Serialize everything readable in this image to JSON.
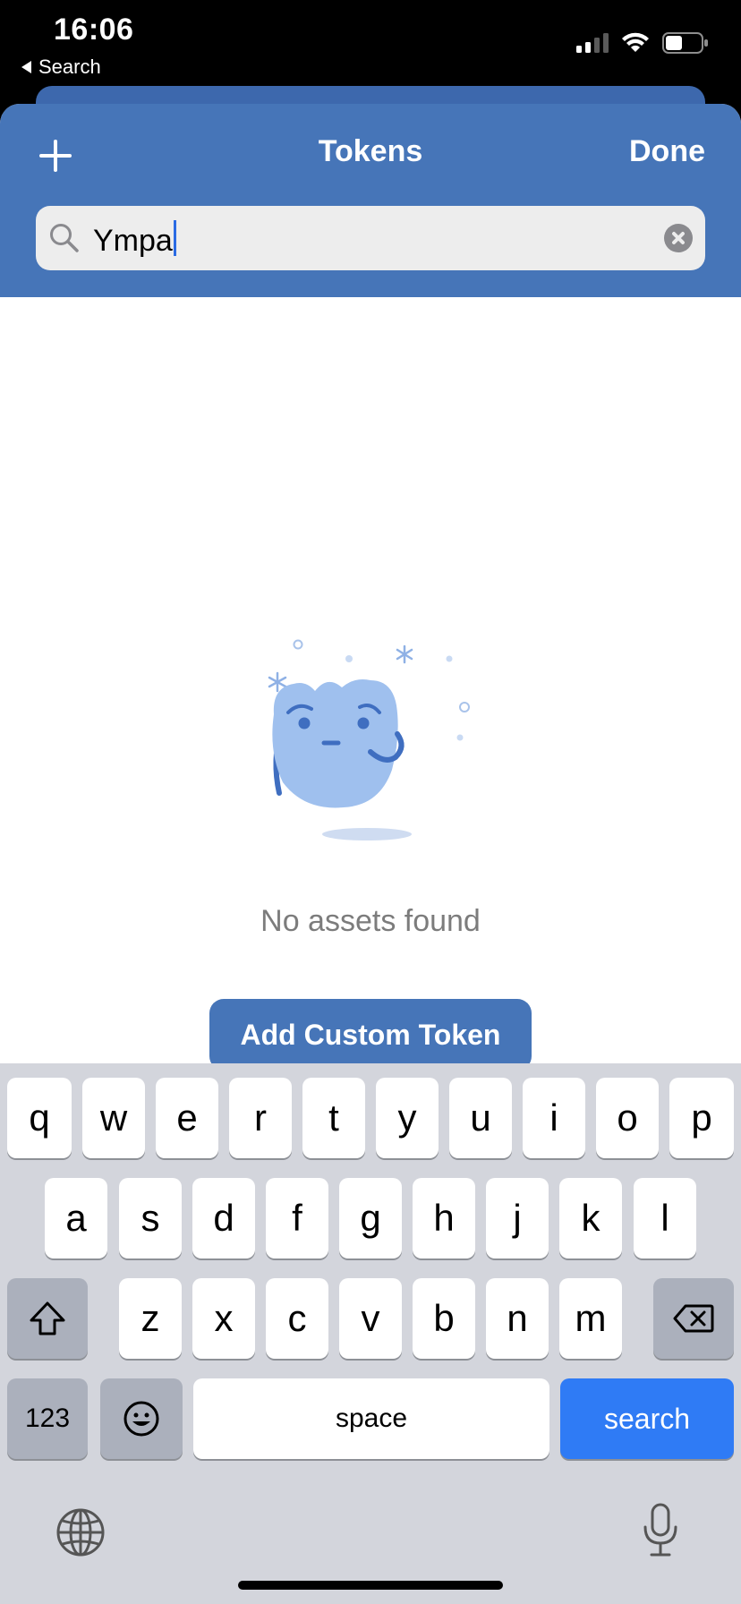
{
  "status_bar": {
    "time": "16:06",
    "back_app": "Search",
    "icons": [
      "cellular-signal-icon",
      "wifi-icon",
      "battery-icon"
    ]
  },
  "nav": {
    "title": "Tokens",
    "done_label": "Done",
    "add_icon": "plus-icon"
  },
  "search": {
    "value": "Ympa",
    "icon": "search-icon",
    "clear_icon": "clear-icon"
  },
  "empty_state": {
    "message": "No assets found",
    "illustration": "confused-blob-illustration"
  },
  "add_button": {
    "label": "Add Custom Token"
  },
  "keyboard": {
    "row1": [
      "q",
      "w",
      "e",
      "r",
      "t",
      "y",
      "u",
      "i",
      "o",
      "p"
    ],
    "row2": [
      "a",
      "s",
      "d",
      "f",
      "g",
      "h",
      "j",
      "k",
      "l"
    ],
    "row3": [
      "z",
      "x",
      "c",
      "v",
      "b",
      "n",
      "m"
    ],
    "numbers_label": "123",
    "space_label": "space",
    "search_label": "search"
  },
  "colors": {
    "brand": "#4675b8",
    "keyboard_bg": "#d3d5dc",
    "search_key": "#2f7bf5"
  }
}
